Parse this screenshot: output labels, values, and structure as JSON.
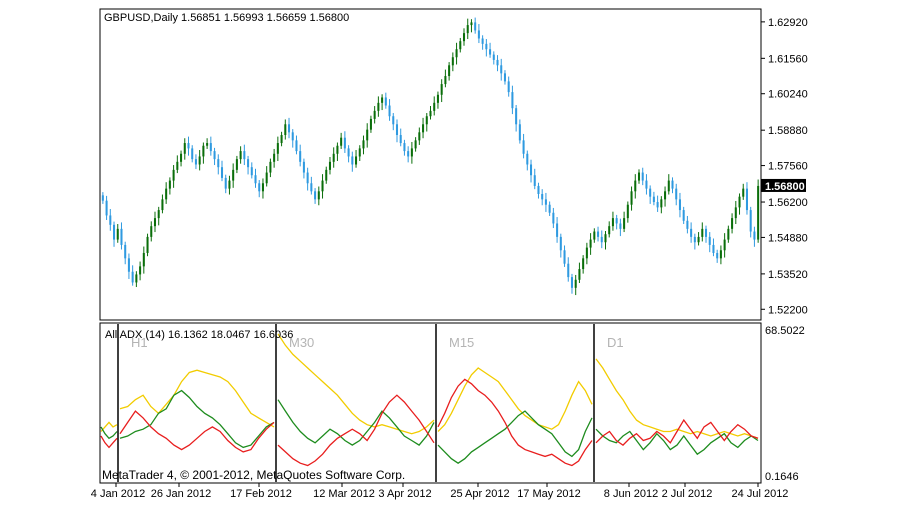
{
  "colors": {
    "bull": "#0a6e0a",
    "bear": "#2f9ae0",
    "border": "#000000",
    "adx": "#f2cc00",
    "plus_di": "#1e8c1e",
    "minus_di": "#e81e1e",
    "tf_label": "#b4b4b4",
    "price_tag_bg": "#000000",
    "price_tag_fg": "#ffffff"
  },
  "main_header": "GBPUSD,Daily  1.56851 1.56993 1.56659 1.56800",
  "current_price": "1.56800",
  "indicator_header": "All ADX (14) 16.1362 18.0467 16.6036",
  "indicator_scale": {
    "top": "68.5022",
    "bottom": "0.1646"
  },
  "copyright": "MetaTrader 4, © 2001-2012, MetaQuotes Software Corp.",
  "chart_data": {
    "type": "candlestick",
    "symbol": "GBPUSD",
    "timeframe": "Daily",
    "ohlc_last": {
      "open": 1.56851,
      "high": 1.56993,
      "low": 1.56659,
      "close": 1.568
    },
    "y_ticks": [
      "1.62920",
      "1.61560",
      "1.60240",
      "1.58880",
      "1.57560",
      "1.56200",
      "1.54880",
      "1.53520",
      "1.52200"
    ],
    "ylim": [
      1.518,
      1.634
    ],
    "x_ticks": [
      "4 Jan 2012",
      "26 Jan 2012",
      "17 Feb 2012",
      "12 Mar 2012",
      "3 Apr 2012",
      "25 Apr 2012",
      "17 May 2012",
      "8 Jun 2012",
      "2 Jul 2012",
      "24 Jul 2012"
    ],
    "closes": [
      1.5625,
      1.557,
      1.5535,
      1.548,
      1.552,
      1.546,
      1.541,
      1.536,
      1.532,
      1.535,
      1.538,
      1.543,
      1.549,
      1.553,
      1.556,
      1.559,
      1.563,
      1.567,
      1.57,
      1.574,
      1.577,
      1.58,
      1.584,
      1.582,
      1.578,
      1.576,
      1.579,
      1.583,
      1.584,
      1.581,
      1.578,
      1.575,
      1.571,
      1.567,
      1.57,
      1.574,
      1.578,
      1.581,
      1.578,
      1.575,
      1.572,
      1.569,
      1.566,
      1.569,
      1.573,
      1.577,
      1.58,
      1.584,
      1.587,
      1.591,
      1.588,
      1.585,
      1.581,
      1.577,
      1.573,
      1.569,
      1.566,
      1.563,
      1.566,
      1.57,
      1.574,
      1.577,
      1.58,
      1.583,
      1.586,
      1.582,
      1.579,
      1.576,
      1.579,
      1.582,
      1.585,
      1.589,
      1.593,
      1.596,
      1.599,
      1.601,
      1.598,
      1.594,
      1.591,
      1.587,
      1.584,
      1.581,
      1.579,
      1.582,
      1.585,
      1.588,
      1.591,
      1.594,
      1.596,
      1.599,
      1.602,
      1.606,
      1.609,
      1.613,
      1.616,
      1.619,
      1.622,
      1.625,
      1.628,
      1.629,
      1.626,
      1.623,
      1.621,
      1.619,
      1.617,
      1.615,
      1.613,
      1.61,
      1.607,
      1.603,
      1.597,
      1.591,
      1.585,
      1.58,
      1.576,
      1.572,
      1.568,
      1.565,
      1.563,
      1.561,
      1.558,
      1.554,
      1.549,
      1.544,
      1.539,
      1.534,
      1.53,
      1.533,
      1.537,
      1.541,
      1.545,
      1.548,
      1.551,
      1.549,
      1.547,
      1.55,
      1.553,
      1.556,
      1.554,
      1.552,
      1.556,
      1.561,
      1.566,
      1.57,
      1.573,
      1.57,
      1.567,
      1.564,
      1.562,
      1.56,
      1.563,
      1.566,
      1.57,
      1.567,
      1.563,
      1.559,
      1.555,
      1.552,
      1.549,
      1.547,
      1.549,
      1.552,
      1.549,
      1.546,
      1.543,
      1.541,
      1.544,
      1.548,
      1.552,
      1.556,
      1.56,
      1.564,
      1.567,
      1.559,
      1.551,
      1.548,
      1.568
    ],
    "indicator": {
      "name": "All ADX (14)",
      "values": [
        16.1362,
        18.0467,
        16.6036
      ],
      "ylim": [
        0.1646,
        68.5022
      ],
      "timeframe_labels": [
        "H1",
        "M30",
        "M15",
        "D1"
      ],
      "panels": [
        {
          "label": "",
          "adx": [
            22,
            24,
            26,
            24,
            25
          ],
          "plus_di": [
            24,
            21,
            19,
            20,
            22
          ],
          "minus_di": [
            20,
            17,
            15,
            17,
            19
          ]
        },
        {
          "label": "H1",
          "adx": [
            32,
            33,
            36,
            38,
            33,
            30,
            34,
            38,
            44,
            48,
            49,
            48,
            47,
            46,
            44,
            40,
            35,
            30,
            28,
            26,
            24
          ],
          "plus_di": [
            19,
            20,
            22,
            23,
            25,
            30,
            32,
            38,
            40,
            37,
            33,
            30,
            28,
            25,
            21,
            17,
            15,
            16,
            20,
            24,
            26
          ],
          "minus_di": [
            21,
            26,
            31,
            28,
            24,
            21,
            19,
            16,
            14,
            16,
            19,
            22,
            24,
            22,
            18,
            15,
            13,
            14,
            19,
            23,
            26
          ]
        },
        {
          "label": "M30",
          "adx": [
            65,
            60,
            56,
            53,
            50,
            47,
            44,
            41,
            38,
            34,
            30,
            27,
            25,
            24,
            25,
            24,
            23,
            22,
            21,
            22,
            24,
            27
          ],
          "plus_di": [
            36,
            31,
            26,
            22,
            19,
            17,
            20,
            23,
            21,
            18,
            16,
            18,
            22,
            26,
            31,
            28,
            24,
            20,
            18,
            16,
            20,
            26
          ],
          "minus_di": [
            16,
            13,
            10,
            8,
            7,
            9,
            12,
            16,
            19,
            21,
            23,
            21,
            18,
            23,
            30,
            35,
            38,
            35,
            31,
            27,
            22,
            17
          ]
        },
        {
          "label": "M15",
          "adx": [
            22,
            25,
            30,
            36,
            42,
            47,
            50,
            48,
            46,
            44,
            40,
            36,
            32,
            29,
            27,
            25,
            24,
            23,
            25,
            31,
            38,
            44,
            40,
            34
          ],
          "plus_di": [
            16,
            13,
            10,
            8,
            10,
            13,
            15,
            17,
            19,
            21,
            23,
            26,
            29,
            31,
            28,
            25,
            23,
            21,
            17,
            13,
            11,
            14,
            22,
            28
          ],
          "minus_di": [
            24,
            30,
            37,
            42,
            45,
            43,
            40,
            38,
            35,
            31,
            26,
            20,
            16,
            14,
            13,
            12,
            11,
            12,
            10,
            8,
            7,
            9,
            14,
            18
          ]
        },
        {
          "label": "D1",
          "adx": [
            54,
            50,
            45,
            40,
            36,
            31,
            27,
            25,
            24,
            23,
            22,
            22,
            23,
            22,
            21,
            22,
            21,
            20,
            21,
            22,
            21,
            20,
            21,
            20,
            19
          ],
          "plus_di": [
            23,
            20,
            18,
            17,
            20,
            22,
            18,
            14,
            17,
            21,
            18,
            14,
            16,
            20,
            16,
            12,
            14,
            17,
            19,
            21,
            17,
            15,
            18,
            20,
            18
          ],
          "minus_di": [
            17,
            20,
            22,
            18,
            16,
            19,
            21,
            18,
            19,
            22,
            20,
            17,
            22,
            27,
            23,
            19,
            24,
            26,
            22,
            18,
            22,
            25,
            23,
            20,
            19
          ]
        }
      ]
    }
  }
}
